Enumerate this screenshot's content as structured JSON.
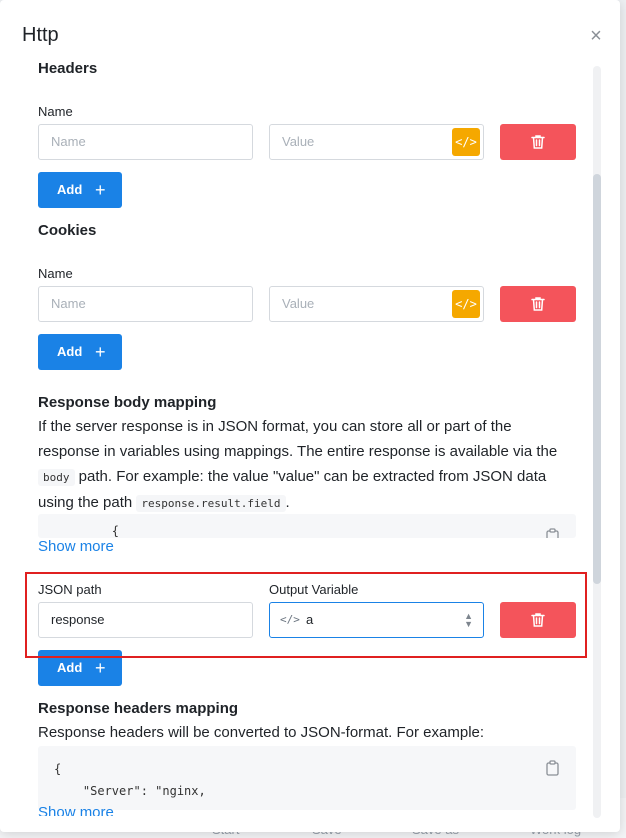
{
  "dialog": {
    "title": "Http",
    "close_icon": "close-icon"
  },
  "headers": {
    "title": "Headers",
    "name_label": "Name",
    "name_placeholder": "Name",
    "value_placeholder": "Value",
    "add_label": "Add"
  },
  "cookies": {
    "title": "Cookies",
    "name_label": "Name",
    "name_placeholder": "Name",
    "value_placeholder": "Value",
    "add_label": "Add"
  },
  "body_mapping": {
    "title": "Response body mapping",
    "text_1": "If the server response is in JSON format, you can store all or part of the response in variables using mappings. The entire response is available via the ",
    "code_1": "body",
    "text_2": " path. For example: the value \"value\" can be extracted from JSON data using the path ",
    "code_2": "response.result.field",
    "text_3": ".",
    "code_preview": "        {",
    "show_more": "Show more",
    "json_path_label": "JSON path",
    "output_variable_label": "Output Variable",
    "json_path_value": "response",
    "output_variable_value": "a",
    "add_label": "Add"
  },
  "headers_mapping": {
    "title": "Response headers mapping",
    "text": "Response headers will be converted to JSON-format. For example:",
    "code_line_1": "{",
    "code_line_2": "    \"Server\": \"nginx,",
    "show_more": "Show more"
  },
  "background_toolbar": {
    "items": [
      "Start",
      "Save",
      "Save as",
      "Work log"
    ]
  },
  "colors": {
    "primary": "#1a82e6",
    "danger": "#f4545b",
    "warning": "#f5a800",
    "highlight": "#e02020"
  }
}
